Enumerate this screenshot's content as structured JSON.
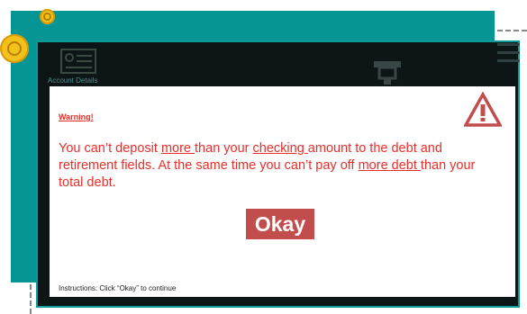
{
  "colors": {
    "teal": "#069595",
    "app_background": "#0e1517",
    "warning_red": "#ea2f2b",
    "button_red": "#c24d4d",
    "coin_gold": "#f2c21b"
  },
  "icons": {
    "coin_small": "coin-icon",
    "coin_large": "coin-icon",
    "account": "account-details-icon",
    "atm": "atm-icon",
    "menu": "hamburger-menu-icon",
    "warning": "warning-triangle-icon"
  },
  "app": {
    "account_details_label": "Account Details"
  },
  "dialog": {
    "title": "Warning!",
    "message": {
      "part1": "You can’t deposit ",
      "link1": "more ",
      "part2": "than your ",
      "link2": "checking ",
      "part3": "amount to the debt and retirement fields. At the same time you can’t pay off ",
      "link3": "more debt ",
      "part4": "than your total debt."
    },
    "button_label": "Okay",
    "instructions": "Instructions: Click “Okay” to continue"
  }
}
